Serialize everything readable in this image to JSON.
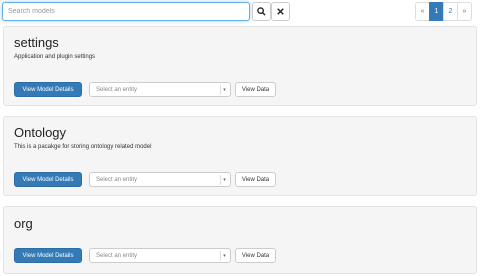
{
  "search": {
    "placeholder": "Search models",
    "search_icon": "magnifier",
    "clear_icon": "x"
  },
  "pagination": {
    "prev": "«",
    "pages": [
      "1",
      "2"
    ],
    "active": "1",
    "next": "»"
  },
  "models": [
    {
      "name": "settings",
      "description": "Application and plugin settings",
      "view_details": "View Model Details",
      "entity_placeholder": "Select an entity",
      "view_data": "View Data"
    },
    {
      "name": "Ontology",
      "description": "This is a pacakge for storing ontology related model",
      "view_details": "View Model Details",
      "entity_placeholder": "Select an entity",
      "view_data": "View Data"
    },
    {
      "name": "org",
      "description": "",
      "view_details": "View Model Details",
      "entity_placeholder": "Select an entity",
      "view_data": "View Data"
    }
  ],
  "colors": {
    "primary": "#337ab7",
    "card_bg": "#f5f5f5",
    "focus": "#66afe9"
  }
}
